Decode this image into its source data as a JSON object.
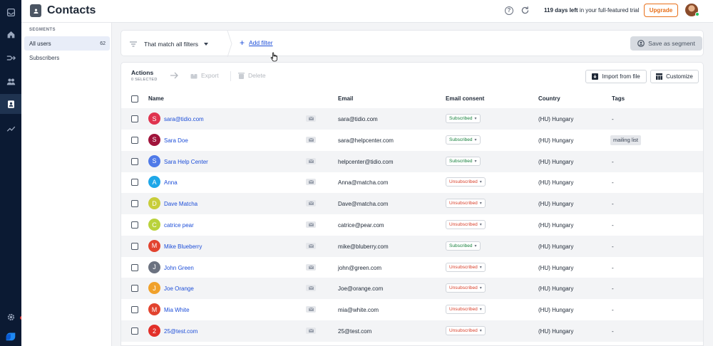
{
  "topbar": {
    "title": "Contacts",
    "trial_bold": "119 days left",
    "trial_rest": " in your full-featured trial",
    "upgrade_label": "Upgrade"
  },
  "sidebar_icons": [
    "inbox-icon",
    "home-icon",
    "flows-icon",
    "visitors-icon",
    "contacts-icon",
    "analytics-icon",
    "settings-icon",
    "tidio-logo-icon"
  ],
  "segments": {
    "heading": "SEGMENTS",
    "items": [
      {
        "label": "All users",
        "count": "62",
        "active": true
      },
      {
        "label": "Subscribers",
        "count": "",
        "active": false
      }
    ]
  },
  "filters": {
    "match_label": "That match all filters",
    "add_filter_label": "Add filter",
    "save_segment_label": "Save as segment"
  },
  "actions": {
    "title": "Actions",
    "selected_text": "0 SELECTED",
    "export_label": "Export",
    "delete_label": "Delete",
    "import_label": "Import from file",
    "customize_label": "Customize"
  },
  "table": {
    "headers": {
      "name": "Name",
      "email": "Email",
      "consent": "Email consent",
      "country": "Country",
      "tags": "Tags"
    },
    "rows": [
      {
        "initial": "S",
        "name": "sara@tidio.com",
        "email": "sara@tidio.com",
        "consent": "Subscribed",
        "country": "(HU) Hungary",
        "tags": "-",
        "avatar_color": "#e0344f"
      },
      {
        "initial": "S",
        "name": "Sara Doe",
        "email": "sara@helpcenter.com",
        "consent": "Subscribed",
        "country": "(HU) Hungary",
        "tags": "mailing list",
        "avatar_color": "#a0143b"
      },
      {
        "initial": "S",
        "name": "Sara Help Center",
        "email": "helpcenter@tidio.com",
        "consent": "Subscribed",
        "country": "(HU) Hungary",
        "tags": "-",
        "avatar_color": "#4f7ae8"
      },
      {
        "initial": "A",
        "name": "Anna",
        "email": "Anna@matcha.com",
        "consent": "Unsubscribed",
        "country": "(HU) Hungary",
        "tags": "-",
        "avatar_color": "#1ea7e8"
      },
      {
        "initial": "D",
        "name": "Dave Matcha",
        "email": "Dave@matcha.com",
        "consent": "Unsubscribed",
        "country": "(HU) Hungary",
        "tags": "-",
        "avatar_color": "#c8cd3a"
      },
      {
        "initial": "C",
        "name": "catrice pear",
        "email": "catrice@pear.com",
        "consent": "Unsubscribed",
        "country": "(HU) Hungary",
        "tags": "-",
        "avatar_color": "#b9d23c"
      },
      {
        "initial": "M",
        "name": "Mike Blueberry",
        "email": "mike@bluberry.com",
        "consent": "Subscribed",
        "country": "(HU) Hungary",
        "tags": "-",
        "avatar_color": "#e2432f"
      },
      {
        "initial": "J",
        "name": "John Green",
        "email": "john@green.com",
        "consent": "Unsubscribed",
        "country": "(HU) Hungary",
        "tags": "-",
        "avatar_color": "#6b7280"
      },
      {
        "initial": "J",
        "name": "Joe Orange",
        "email": "Joe@orange.com",
        "consent": "Unsubscribed",
        "country": "(HU) Hungary",
        "tags": "-",
        "avatar_color": "#f0a12b"
      },
      {
        "initial": "M",
        "name": "Mia White",
        "email": "mia@white.com",
        "consent": "Unsubscribed",
        "country": "(HU) Hungary",
        "tags": "-",
        "avatar_color": "#e2432f"
      },
      {
        "initial": "2",
        "name": "25@test.com",
        "email": "25@test.com",
        "consent": "Unsubscribed",
        "country": "(HU) Hungary",
        "tags": "-",
        "avatar_color": "#e2302a"
      }
    ]
  },
  "colors": {
    "rail": "#0b1a33",
    "link": "#1d4ed8",
    "subscribed": "#16803c",
    "unsubscribed": "#d9402b",
    "upgrade": "#e8701a"
  }
}
